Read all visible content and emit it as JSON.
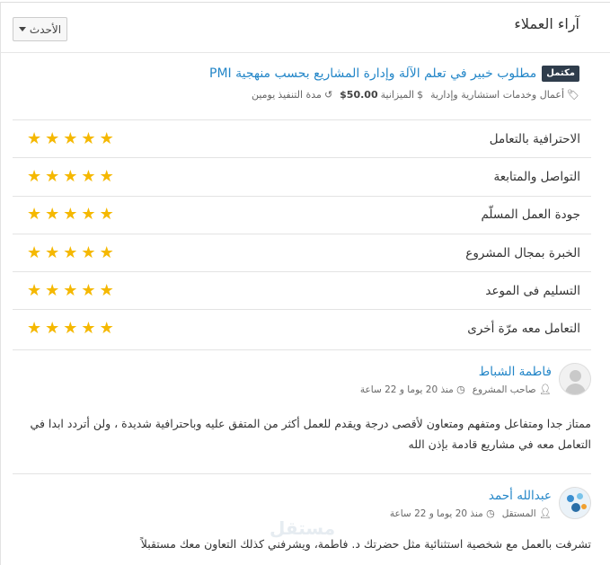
{
  "panel": {
    "title": "آراء العملاء",
    "sort_label": "الأحدث"
  },
  "project": {
    "badge": "مكتمل",
    "title": "مطلوب خبير في تعلم الآلة وإدارة المشاريع بحسب منهجية PMI",
    "category": "أعمال وخدمات استشارية وإدارية",
    "budget_label": "الميزانية",
    "budget_value": "$50.00",
    "duration_label": "مدة التنفيذ",
    "duration_value": "يومين"
  },
  "ratings": [
    {
      "label": "الاحترافية بالتعامل",
      "stars": 5
    },
    {
      "label": "التواصل والمتابعة",
      "stars": 5
    },
    {
      "label": "جودة العمل المسلّم",
      "stars": 5
    },
    {
      "label": "الخبرة بمجال المشروع",
      "stars": 5
    },
    {
      "label": "التسليم فى الموعد",
      "stars": 5
    },
    {
      "label": "التعامل معه مرّة أخرى",
      "stars": 5
    }
  ],
  "reviews": [
    {
      "name": "فاطمة الشباط",
      "role": "صاحب المشروع",
      "time": "منذ 20 يوما و 22 ساعة",
      "text": "ممتاز جدا ومتفاعل ومتفهم ومتعاون لأقصى درجة ويقدم للعمل أكثر من المتفق عليه وباحترافية شديدة ، ولن أتردد ابدا في التعامل معه في مشاريع قادمة بإذن الله"
    },
    {
      "name": "عبدالله أحمد",
      "role": "المستقل",
      "time": "منذ 20 يوما و 22 ساعة",
      "text": "تشرفت بالعمل مع شخصية استثنائية مثل حضرتك د. فاطمة، ويشرفني كذلك التعاون معك مستقبلاً"
    }
  ],
  "watermark": "مستقل",
  "colors": {
    "link": "#2386c8",
    "star": "#f5b800",
    "badge": "#2f3d4c"
  },
  "icons": {
    "category": "tag-icon",
    "budget": "dollar-icon",
    "duration": "clock-icon",
    "role": "user-icon",
    "time": "clock-icon"
  }
}
